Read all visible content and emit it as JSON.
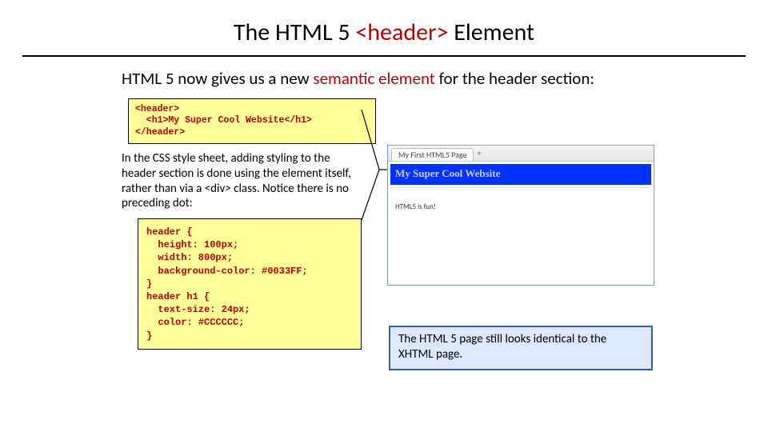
{
  "title_prefix": "The HTML 5 ",
  "title_red": "<header>",
  "title_suffix": " Element",
  "intro_prefix": "HTML 5 now gives us a new ",
  "intro_red": "semantic element",
  "intro_suffix": " for the header section:",
  "code1": "<header>\n  <h1>My Super Cool Website</h1>\n</header>",
  "explain": "In the CSS style sheet, adding styling to the header section is done using the element itself, rather than via a <div> class. Notice there is no preceding dot:",
  "code2": "header {\n  height: 100px;\n  width: 800px;\n  background-color: #0033FF;\n}\nheader h1 {\n  text-size: 24px;\n  color: #CCCCCC;\n}",
  "preview": {
    "tab": "My First HTML5 Page",
    "heading": "My Super Cool Website",
    "body": "HTML5 is fun!"
  },
  "bottom_note": "The HTML 5 page still looks identical to the XHTML page."
}
